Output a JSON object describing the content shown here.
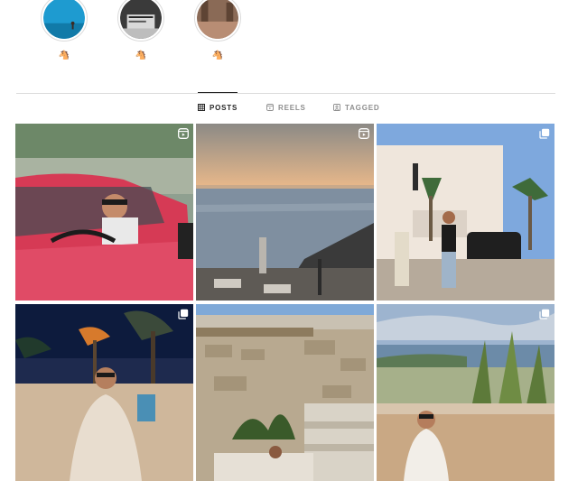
{
  "highlights": [
    {
      "label": "🐴",
      "icon": "beach-cover"
    },
    {
      "label": "🐴",
      "icon": "laptop-cover"
    },
    {
      "label": "🐴",
      "icon": "street-cover"
    }
  ],
  "tabs": [
    {
      "label": "POSTS",
      "icon": "grid-icon",
      "active": true
    },
    {
      "label": "REELS",
      "icon": "reels-icon",
      "active": false
    },
    {
      "label": "TAGGED",
      "icon": "tagged-icon",
      "active": false
    }
  ],
  "posts": [
    {
      "subject": "man in red convertible",
      "badge": "reel-icon"
    },
    {
      "subject": "sunset over sea with terrace",
      "badge": "reel-icon"
    },
    {
      "subject": "man by white building and car",
      "badge": "carousel-icon"
    },
    {
      "subject": "man at night with palm trees",
      "badge": "carousel-icon"
    },
    {
      "subject": "stone wall terrace",
      "badge": "none"
    },
    {
      "subject": "man on terrace overlooking bay",
      "badge": "carousel-icon"
    }
  ],
  "colors": {
    "accent": "#262626",
    "muted": "#8e8e8e",
    "border": "#dbdbdb"
  }
}
